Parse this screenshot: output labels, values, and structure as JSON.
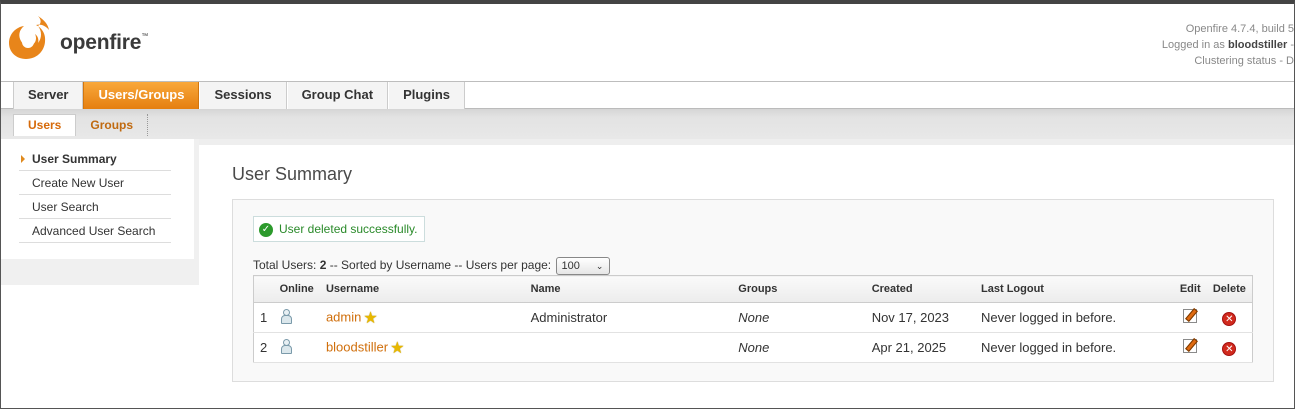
{
  "header": {
    "logo_text": "openfire",
    "logo_tm": "™",
    "version": "Openfire 4.7.4, build 5",
    "logged_in_prefix": "Logged in as ",
    "logged_in_user": "bloodstiller",
    "logged_in_suffix": " -",
    "clustering": "Clustering status - D"
  },
  "main_tabs": [
    "Server",
    "Users/Groups",
    "Sessions",
    "Group Chat",
    "Plugins"
  ],
  "sub_tabs": [
    "Users",
    "Groups"
  ],
  "sidebar": {
    "items": [
      "User Summary",
      "Create New User",
      "User Search",
      "Advanced User Search"
    ]
  },
  "page": {
    "title": "User Summary",
    "success_message": "User deleted successfully.",
    "total_label": "Total Users: ",
    "total_count": "2",
    "sorted_text": " -- Sorted by Username -- Users per page: ",
    "per_page": "100"
  },
  "table": {
    "headers": [
      "",
      "Online",
      "Username",
      "Name",
      "Groups",
      "Created",
      "Last Logout",
      "Edit",
      "Delete"
    ],
    "rows": [
      {
        "num": "1",
        "username": "admin",
        "name": "Administrator",
        "groups": "None",
        "created": "Nov 17, 2023",
        "last_logout": "Never logged in before."
      },
      {
        "num": "2",
        "username": "bloodstiller",
        "name": "",
        "groups": "None",
        "created": "Apr 21, 2025",
        "last_logout": "Never logged in before."
      }
    ]
  },
  "colors": {
    "accent": "#e8851a",
    "link": "#d06f0c",
    "success": "#2a8a2a"
  }
}
